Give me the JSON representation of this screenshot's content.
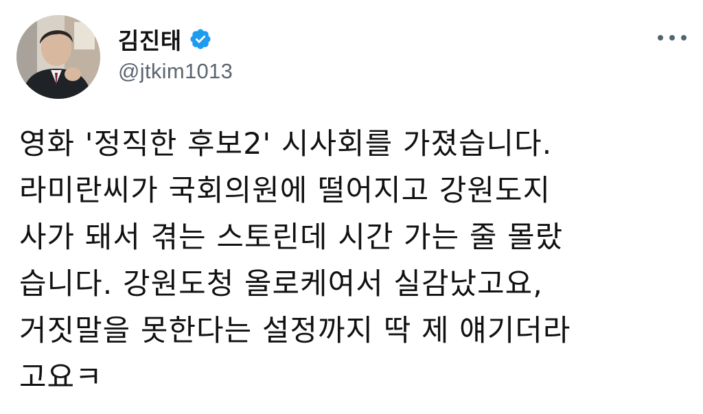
{
  "author": {
    "name": "김진태",
    "handle": "@jtkim1013",
    "verified": true,
    "verified_color": "#1d9bf0",
    "avatar_icon": "profile-photo"
  },
  "more_icon": "more-horizontal-icon",
  "tweet": {
    "lines": [
      "영화 '정직한 후보2' 시사회를 가졌습니다.",
      "라미란씨가 국회의원에 떨어지고 강원도지",
      "사가 돼서 겪는 스토린데 시간 가는 줄 몰랐",
      "습니다. 강원도청 올로케여서 실감났고요,",
      "거짓말을 못한다는 설정까지 딱 제 얘기더라",
      "고요ㅋ"
    ]
  }
}
